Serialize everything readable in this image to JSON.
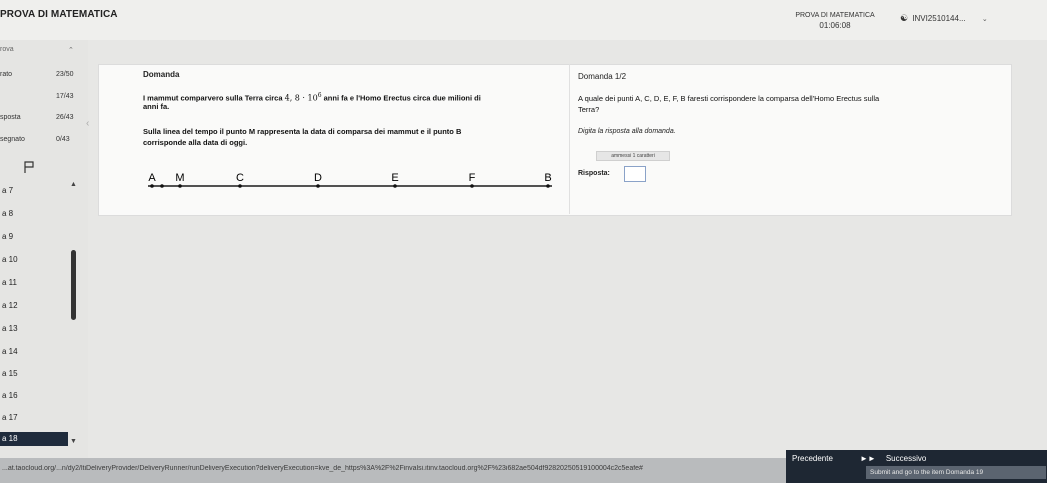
{
  "header": {
    "app_title": "PROVA DI MATEMATICA",
    "center_title": "PROVA DI MATEMATICA",
    "timer": "01:06:08",
    "user": "INVI2510144..."
  },
  "sidebar": {
    "section": "rova",
    "stats": [
      {
        "label": "rato",
        "value": "23/50"
      },
      {
        "label": "",
        "value": "17/43"
      },
      {
        "label": "sposta",
        "value": "26/43"
      },
      {
        "label": "segnato",
        "value": "0/43"
      }
    ],
    "items": [
      {
        "label": "a 7"
      },
      {
        "label": "a 8"
      },
      {
        "label": "a 9"
      },
      {
        "label": "a 10"
      },
      {
        "label": "a 11"
      },
      {
        "label": "a 12"
      },
      {
        "label": "a 13"
      },
      {
        "label": "a 14"
      },
      {
        "label": "a 15"
      },
      {
        "label": "a 16"
      },
      {
        "label": "a 17"
      },
      {
        "label": "a 18"
      }
    ]
  },
  "question": {
    "stimulus_title": "Domanda",
    "stimulus_text_1": "I mammut comparvero sulla Terra circa",
    "stimulus_math": "4, 8 · 10",
    "stimulus_exp": "6",
    "stimulus_text_2": "anni fa e l'Homo Erectus circa due milioni di",
    "stimulus_text_3": "anni fa.",
    "stimulus_text_4": "Sulla linea del tempo il punto M rappresenta la data di comparsa dei mammut e il punto B",
    "stimulus_text_5": "corrisponde alla data di oggi.",
    "points": [
      "A",
      "M",
      "C",
      "D",
      "E",
      "F",
      "B"
    ],
    "prompt_title": "Domanda 1/2",
    "prompt_text_1": "A quale dei punti A, C, D, E, F, B faresti corrispondere la comparsa dell'Homo Erectus sulla",
    "prompt_text_2": "Terra?",
    "instruction": "Digita la risposta alla domanda.",
    "counter": "ammessi 1 caratteri",
    "answer_label": "Risposta:",
    "answer_value": ""
  },
  "footer": {
    "url": "...at.taocloud.org/...n/dy2/ltiDeliveryProvider/DeliveryRunner/runDeliveryExecution?deliveryExecution=kve_de_https%3A%2F%2Finvalsi.itinv.taocloud.org%2F%23i682ae504df92820250519100004c2c5eafe#",
    "prev_label": "Precedente",
    "next_label": "Successivo",
    "submit_hint": "Submit and go to the item Domanda 19"
  }
}
